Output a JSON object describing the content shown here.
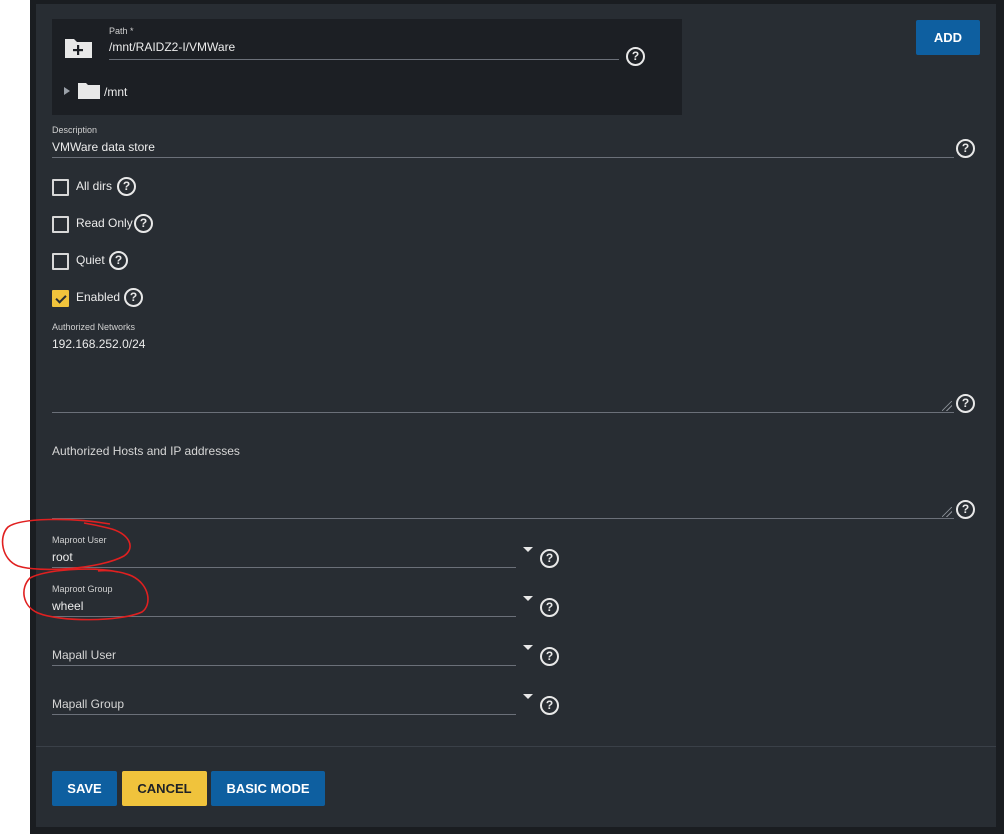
{
  "path_section": {
    "label": "Path *",
    "value": "/mnt/RAIDZ2-I/VMWare",
    "tree_root": "/mnt",
    "add_button": "ADD"
  },
  "description": {
    "label": "Description",
    "value": "VMWare data store"
  },
  "checkboxes": [
    {
      "label": "All dirs",
      "checked": false
    },
    {
      "label": "Read Only",
      "checked": false
    },
    {
      "label": "Quiet",
      "checked": false
    },
    {
      "label": "Enabled",
      "checked": true
    }
  ],
  "authorized_networks": {
    "label": "Authorized Networks",
    "value": "192.168.252.0/24"
  },
  "authorized_hosts": {
    "placeholder": "Authorized Hosts and IP addresses"
  },
  "maproot_user": {
    "label": "Maproot User",
    "value": "root"
  },
  "maproot_group": {
    "label": "Maproot Group",
    "value": "wheel"
  },
  "mapall_user": {
    "placeholder": "Mapall User"
  },
  "mapall_group": {
    "placeholder": "Mapall Group"
  },
  "help_icon_glyph": "?",
  "buttons": {
    "save": "SAVE",
    "cancel": "CANCEL",
    "basic_mode": "BASIC MODE"
  },
  "colors": {
    "background": "#282d33",
    "primary": "#0e5fa0",
    "accent": "#f0c33c",
    "annotation": "#e02020"
  }
}
